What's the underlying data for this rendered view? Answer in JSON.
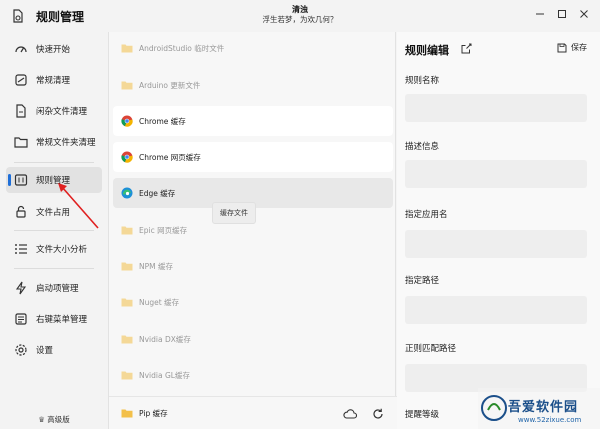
{
  "app": {
    "title": "规则管理",
    "header_title": "清浊",
    "header_subtitle": "浮生若梦，为欢几何？"
  },
  "sidebar": {
    "items": [
      {
        "label": "快速开始",
        "icon": "speedometer-icon"
      },
      {
        "label": "常规清理",
        "icon": "sweep-icon"
      },
      {
        "label": "闲杂文件清理",
        "icon": "file-icon"
      },
      {
        "label": "常规文件夹清理",
        "icon": "folder-icon"
      },
      {
        "label": "规则管理",
        "icon": "rules-icon",
        "active": true
      },
      {
        "label": "文件占用",
        "icon": "lock-icon"
      },
      {
        "label": "文件大小分析",
        "icon": "list-icon"
      },
      {
        "label": "启动项管理",
        "icon": "bolt-icon"
      },
      {
        "label": "右键菜单管理",
        "icon": "context-menu-icon"
      },
      {
        "label": "设置",
        "icon": "gear-icon"
      }
    ],
    "version": "高级版"
  },
  "rules": {
    "items": [
      {
        "label": "AndroidStudio 临时文件",
        "icon": "folder-icon",
        "dim": true
      },
      {
        "label": "Arduino 更新文件",
        "icon": "folder-icon",
        "dim": true
      },
      {
        "label": "Chrome 缓存",
        "icon": "chrome-icon"
      },
      {
        "label": "Chrome 网页缓存",
        "icon": "chrome-icon"
      },
      {
        "label": "Edge 缓存",
        "icon": "edge-icon",
        "selected": true
      },
      {
        "label": "Epic 网页缓存",
        "icon": "folder-icon",
        "dim": true
      },
      {
        "label": "NPM 缓存",
        "icon": "folder-icon",
        "dim": true
      },
      {
        "label": "Nuget 缓存",
        "icon": "folder-icon",
        "dim": true
      },
      {
        "label": "Nvidia DX缓存",
        "icon": "folder-icon",
        "dim": true
      },
      {
        "label": "Nvidia GL缓存",
        "icon": "folder-icon",
        "dim": true
      },
      {
        "label": "Pip 缓存",
        "icon": "folder-icon"
      }
    ],
    "tooltip": "缓存文件"
  },
  "editor": {
    "title": "规则编辑",
    "save_label": "保存",
    "fields": [
      {
        "label": "规则名称"
      },
      {
        "label": "描述信息"
      },
      {
        "label": "指定应用名"
      },
      {
        "label": "指定路径"
      },
      {
        "label": "正则匹配路径"
      },
      {
        "label": "提醒等级"
      }
    ]
  },
  "watermark": {
    "text": "吾爱软件园",
    "url": "www.52zixue.com"
  },
  "colors": {
    "accent": "#1f6fd8",
    "folder": "#f3c04a",
    "annotation_arrow": "#e02020"
  }
}
